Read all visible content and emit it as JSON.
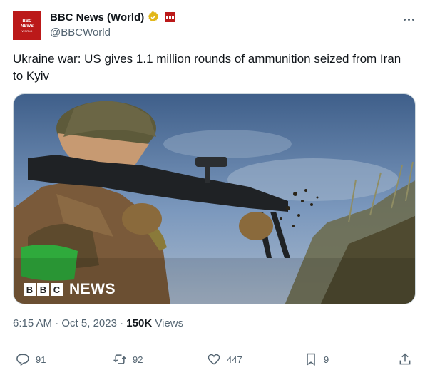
{
  "account": {
    "display_name": "BBC News (World)",
    "handle": "@BBCWorld",
    "avatar_text_top": "BBC",
    "avatar_text_mid": "NEWS",
    "avatar_text_bottom": "WORLD"
  },
  "tweet": {
    "text": "Ukraine war: US gives 1.1 million rounds of ammunition seized from Iran to Kyiv",
    "media_watermark": {
      "letters": [
        "B",
        "B",
        "C"
      ],
      "word": "NEWS"
    }
  },
  "meta": {
    "time": "6:15 AM",
    "separator": "·",
    "date": "Oct 5, 2023",
    "views_count": "150K",
    "views_label": "Views"
  },
  "actions": {
    "replies": "91",
    "reposts": "92",
    "likes": "447",
    "bookmarks": "9"
  },
  "colors": {
    "brand_red": "#bb1919",
    "text_primary": "#0f1419",
    "text_secondary": "#536471",
    "verified_gold": "#e2b719"
  }
}
